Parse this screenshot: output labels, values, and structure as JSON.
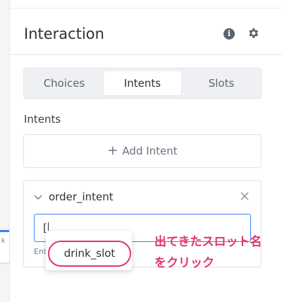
{
  "panel": {
    "title": "Interaction",
    "icons": {
      "info": "info-icon",
      "settings": "gear-icon"
    }
  },
  "left_node": {
    "text": "k"
  },
  "tabs": [
    {
      "label": "Choices",
      "active": false
    },
    {
      "label": "Intents",
      "active": true
    },
    {
      "label": "Slots",
      "active": false
    }
  ],
  "intents_section": {
    "label": "Intents",
    "add_button": "Add Intent"
  },
  "intent": {
    "name": "order_intent",
    "input_value": "[",
    "hint": "Ent"
  },
  "dropdown": {
    "items": [
      "drink_slot"
    ]
  },
  "annotation": {
    "line1": "出てきたスロット名",
    "line2": "をクリック"
  },
  "colors": {
    "accent": "#3b82f6",
    "highlight": "#e2366b"
  }
}
